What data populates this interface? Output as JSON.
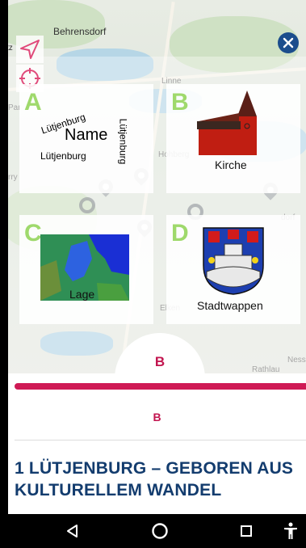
{
  "map": {
    "labels": [
      {
        "id": "behrensdorf",
        "text": "Behrensdorf"
      },
      {
        "id": "tz",
        "text": "tz"
      },
      {
        "id": "linne",
        "text": "Linne"
      },
      {
        "id": "par",
        "text": "Par"
      },
      {
        "id": "hohberg",
        "text": "Hohberg"
      },
      {
        "id": "rry",
        "text": "rry"
      },
      {
        "id": "dorf",
        "text": "dorf"
      },
      {
        "id": "elken",
        "text": "Elken"
      },
      {
        "id": "ness",
        "text": "Ness"
      },
      {
        "id": "rathlau",
        "text": "Rathlau"
      }
    ]
  },
  "tiles": {
    "a": {
      "letter": "A",
      "words": [
        "Lütjenburg",
        "Name",
        "Lütjenburg",
        "Lütjenburg"
      ]
    },
    "b": {
      "letter": "B",
      "caption": "Kirche"
    },
    "c": {
      "letter": "C",
      "caption": "Lage"
    },
    "d": {
      "letter": "D",
      "caption": "Stadtwappen"
    }
  },
  "panel": {
    "tab_label": "B",
    "sub_label": "B",
    "title": "1 LÜTJENBURG – GEBOREN AUS KULTURELLEM WANDEL"
  },
  "colors": {
    "accent": "#cf1a55",
    "title": "#133c6e",
    "letter": "#9fd96c",
    "close": "#1b4d8c"
  },
  "icons": {
    "navigate": "navigation-arrow-icon",
    "locate": "crosshair-icon",
    "close": "close-icon",
    "back": "back-triangle-icon",
    "home": "home-circle-icon",
    "recents": "recents-square-icon",
    "accessibility": "accessibility-icon"
  }
}
